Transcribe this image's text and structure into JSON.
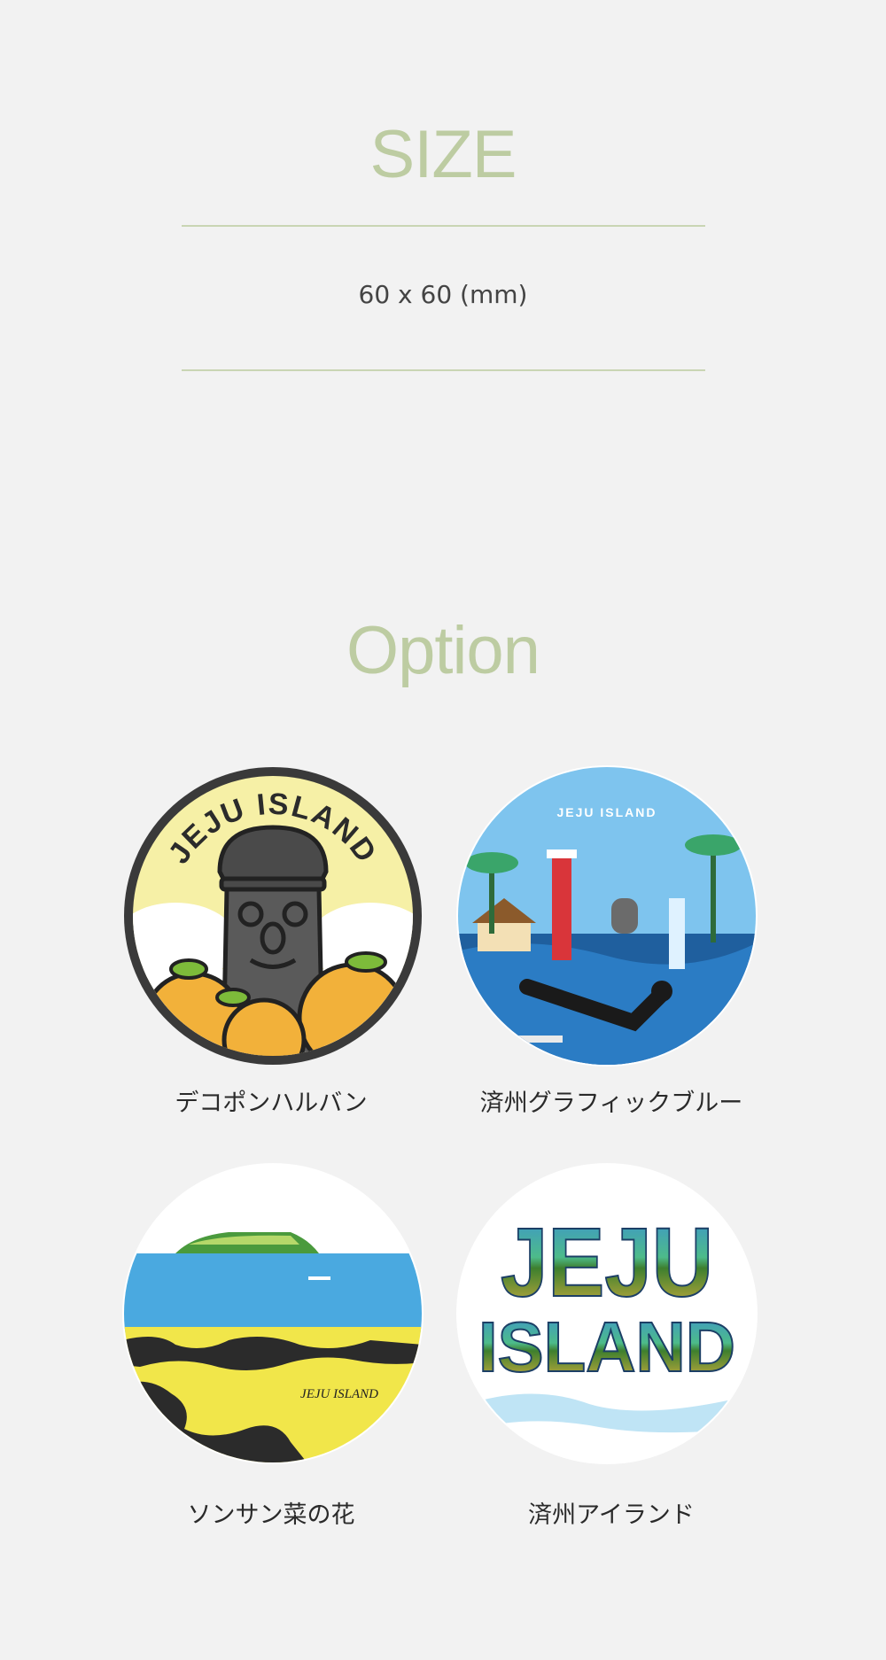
{
  "size_section": {
    "title": "SIZE",
    "value": "60 x 60 (mm)"
  },
  "option_section": {
    "title": "Option",
    "items": [
      {
        "label": "デコポンハルバン",
        "badge_text": "JEJU ISLAND",
        "icon": "dekopon-harubang-badge"
      },
      {
        "label": "済州グラフィックブルー",
        "badge_text": "JEJU ISLAND",
        "icon": "jeju-graphic-blue-badge"
      },
      {
        "label": "ソンサン菜の花",
        "badge_text": "JEJU ISLAND",
        "icon": "seongsan-canola-badge"
      },
      {
        "label": "済州アイランド",
        "badge_text": "JEJU ISLAND",
        "icon": "jeju-island-badge"
      }
    ]
  },
  "colors": {
    "accent": "#bdcca2",
    "rule": "#c9d5b4",
    "background": "#f2f2f2"
  }
}
